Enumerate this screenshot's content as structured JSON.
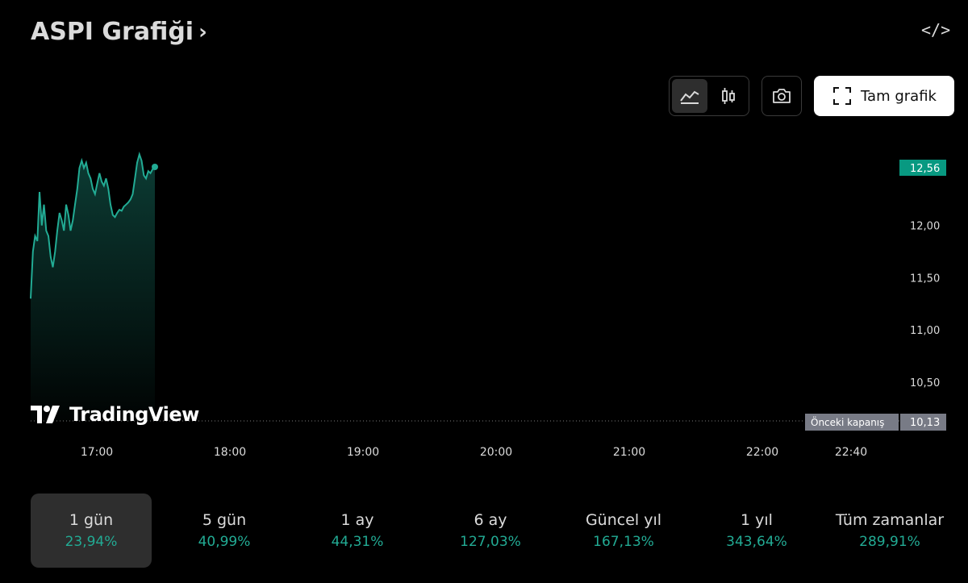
{
  "header": {
    "title": "ASPI Grafiği",
    "chevron": "›",
    "embed_icon": "</>"
  },
  "toolbar": {
    "area_chart_icon": "area-chart-icon",
    "candles_icon": "candlestick-icon",
    "camera_icon": "camera-icon",
    "full_chart_label": "Tam grafik",
    "fullscreen_icon": "fullscreen-icon"
  },
  "branding": {
    "logo_text": "TradingView"
  },
  "colors": {
    "line": "#22ab94",
    "last_price_bg": "#089981",
    "prev_close_bg": "#787b86"
  },
  "chart_data": {
    "type": "area",
    "x_ticks": [
      "17:00",
      "18:00",
      "19:00",
      "20:00",
      "21:00",
      "22:00",
      "22:40"
    ],
    "y_ticks": [
      "12,00",
      "11,50",
      "11,00",
      "10,50"
    ],
    "y_tick_values": [
      12.0,
      11.5,
      11.0,
      10.5
    ],
    "ylim": [
      10.13,
      12.6
    ],
    "last_price": "12,56",
    "prev_close_label": "Önceki kapanış",
    "prev_close_value": "10,13",
    "x_minutes": [
      0,
      1,
      2,
      3,
      4,
      5,
      6,
      7,
      8,
      9,
      10,
      11,
      12,
      13,
      14,
      15,
      16,
      17,
      18,
      19,
      20,
      21,
      22,
      23,
      24,
      25,
      26,
      27,
      28,
      29,
      30,
      31,
      32,
      33,
      34,
      35,
      36,
      37,
      38,
      39,
      40,
      41,
      42,
      43,
      44,
      45,
      46,
      47,
      48,
      49,
      50,
      51,
      52,
      53,
      54,
      55,
      56,
      57,
      58,
      59,
      60,
      61,
      62,
      63,
      64,
      65,
      66,
      67,
      68,
      69,
      70,
      71,
      72,
      73,
      74,
      75,
      76,
      77
    ],
    "x_start": "16:30",
    "values": [
      11.3,
      11.75,
      11.9,
      11.85,
      12.32,
      12.0,
      12.2,
      11.95,
      11.9,
      11.7,
      11.6,
      11.75,
      11.95,
      12.12,
      12.05,
      11.95,
      12.2,
      12.1,
      11.95,
      12.05,
      12.2,
      12.35,
      12.55,
      12.62,
      12.55,
      12.6,
      12.5,
      12.45,
      12.35,
      12.3,
      12.4,
      12.5,
      12.42,
      12.38,
      12.45,
      12.35,
      12.2,
      12.1,
      12.08,
      12.12,
      12.15,
      12.14,
      12.18,
      12.2,
      12.22,
      12.25,
      12.3,
      12.45,
      12.6,
      12.68,
      12.62,
      12.48,
      12.45,
      12.52,
      12.5,
      12.54,
      12.56
    ]
  },
  "periods": [
    {
      "label": "1 gün",
      "value": "23,94%",
      "active": true
    },
    {
      "label": "5 gün",
      "value": "40,99%"
    },
    {
      "label": "1 ay",
      "value": "44,31%"
    },
    {
      "label": "6 ay",
      "value": "127,03%"
    },
    {
      "label": "Güncel yıl",
      "value": "167,13%"
    },
    {
      "label": "1 yıl",
      "value": "343,64%"
    },
    {
      "label": "Tüm zamanlar",
      "value": "289,91%"
    }
  ]
}
